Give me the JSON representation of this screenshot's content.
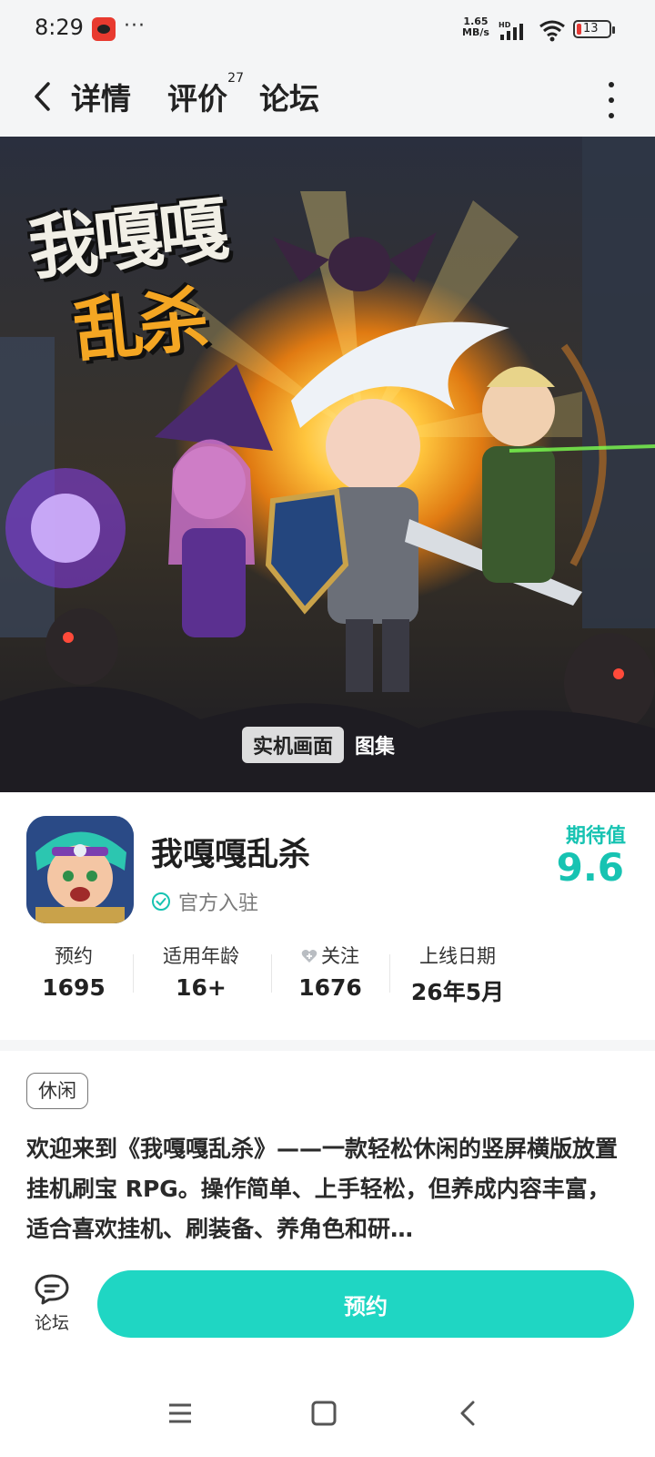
{
  "status_bar": {
    "time": "8:29",
    "more": "···",
    "net_speed_value": "1.65",
    "net_speed_unit": "MB/s",
    "net_type": "HD",
    "battery_level": "13"
  },
  "nav": {
    "tabs": [
      {
        "label": "详情",
        "active": true
      },
      {
        "label": "评价",
        "count": "27"
      },
      {
        "label": "论坛"
      }
    ]
  },
  "hero": {
    "art_title_line1": "我嘎嘎",
    "art_title_line2": "乱杀",
    "gallery_tabs": [
      "实机画面",
      "图集"
    ]
  },
  "app": {
    "name": "我嘎嘎乱杀",
    "verified_label": "官方入驻",
    "expect_label": "期待值",
    "expect_value": "9.6",
    "stats": [
      {
        "label": "预约",
        "value": "1695"
      },
      {
        "label": "适用年龄",
        "value": "16+"
      },
      {
        "label": "关注",
        "value": "1676"
      },
      {
        "label": "上线日期",
        "value": "26年5月"
      }
    ]
  },
  "detail": {
    "tag": "休闲",
    "description": "欢迎来到《我嘎嘎乱杀》——一款轻松休闲的竖屏横版放置挂机刷宝 RPG。操作简单、上手轻松，但养成内容丰富，适合喜欢挂机、刷装备、养角色和研…"
  },
  "bottom_bar": {
    "forum_label": "论坛",
    "reserve_label": "预约"
  },
  "colors": {
    "accent": "#1fd6c3",
    "expect": "#17c3b2"
  }
}
